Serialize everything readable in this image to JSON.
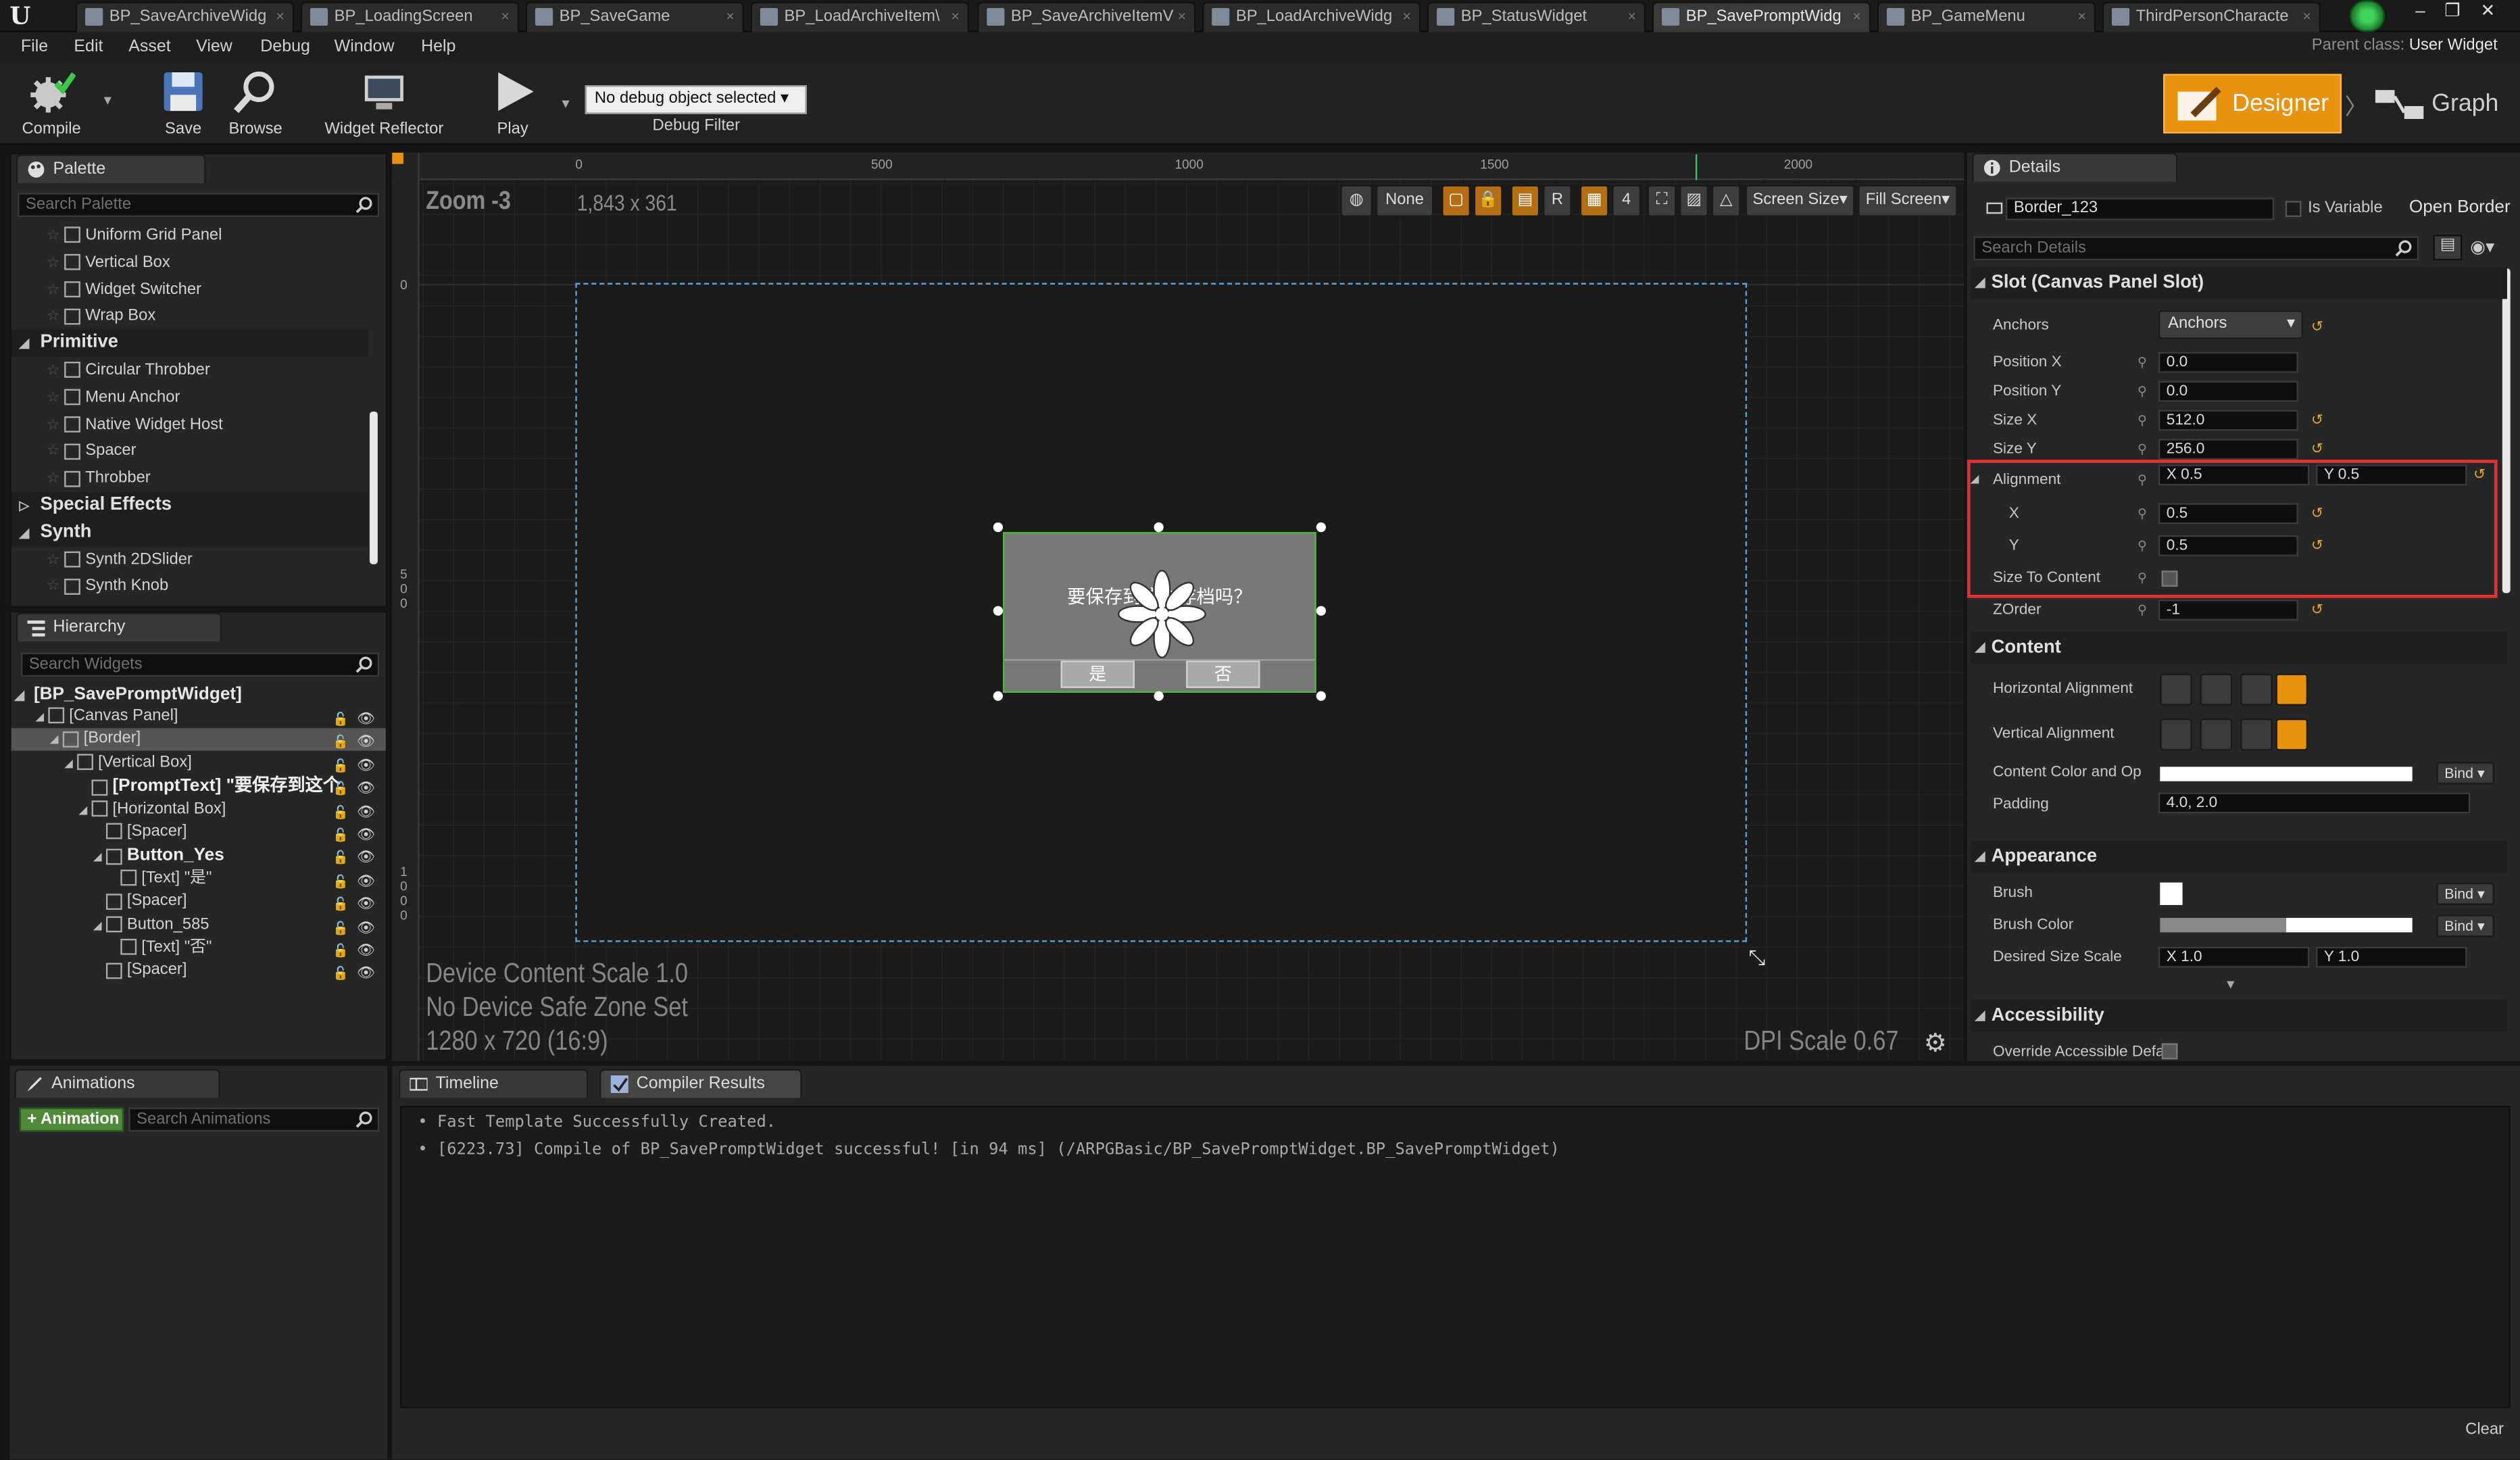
{
  "tabs": [
    {
      "label": "BP_SaveArchiveWidg",
      "active": false
    },
    {
      "label": "BP_LoadingScreen",
      "active": false
    },
    {
      "label": "BP_SaveGame",
      "active": false
    },
    {
      "label": "BP_LoadArchiveItem\\",
      "active": false
    },
    {
      "label": "BP_SaveArchiveItemV",
      "active": false
    },
    {
      "label": "BP_LoadArchiveWidg",
      "active": false
    },
    {
      "label": "BP_StatusWidget",
      "active": false
    },
    {
      "label": "BP_SavePromptWidg",
      "active": true
    },
    {
      "label": "BP_GameMenu",
      "active": false
    },
    {
      "label": "ThirdPersonCharacte",
      "active": false
    }
  ],
  "menu": {
    "items": [
      "File",
      "Edit",
      "Asset",
      "View",
      "Debug",
      "Window",
      "Help"
    ],
    "parent_class_label": "Parent class:",
    "parent_class_value": "User Widget"
  },
  "toolbar": {
    "compile": "Compile",
    "save": "Save",
    "browse": "Browse",
    "widget_reflector": "Widget Reflector",
    "play": "Play",
    "debug_select": "No debug object selected",
    "debug_filter": "Debug Filter",
    "designer": "Designer",
    "graph": "Graph"
  },
  "palette": {
    "title": "Palette",
    "search_placeholder": "Search Palette",
    "items": [
      {
        "type": "item",
        "label": "Uniform Grid Panel"
      },
      {
        "type": "item",
        "label": "Vertical Box"
      },
      {
        "type": "item",
        "label": "Widget Switcher"
      },
      {
        "type": "item",
        "label": "Wrap Box"
      },
      {
        "type": "cat",
        "label": "Primitive"
      },
      {
        "type": "item",
        "label": "Circular Throbber"
      },
      {
        "type": "item",
        "label": "Menu Anchor"
      },
      {
        "type": "item",
        "label": "Native Widget Host"
      },
      {
        "type": "item",
        "label": "Spacer"
      },
      {
        "type": "item",
        "label": "Throbber"
      },
      {
        "type": "cat",
        "label": "Special Effects"
      },
      {
        "type": "cat",
        "label": "Synth"
      },
      {
        "type": "item",
        "label": "Synth 2DSlider"
      },
      {
        "type": "item",
        "label": "Synth Knob"
      }
    ]
  },
  "hierarchy": {
    "title": "Hierarchy",
    "search_placeholder": "Search Widgets",
    "root": "[BP_SavePromptWidget]",
    "rows": [
      {
        "label": "[Canvas Panel]",
        "indent": 1,
        "bold": false,
        "selected": false
      },
      {
        "label": "[Border]",
        "indent": 2,
        "bold": false,
        "selected": true
      },
      {
        "label": "[Vertical Box]",
        "indent": 3,
        "bold": false,
        "selected": false
      },
      {
        "label": "[PromptText] \"要保存到这个",
        "indent": 4,
        "bold": true,
        "selected": false
      },
      {
        "label": "[Horizontal Box]",
        "indent": 4,
        "bold": false,
        "selected": false
      },
      {
        "label": "[Spacer]",
        "indent": 5,
        "bold": false,
        "selected": false
      },
      {
        "label": "Button_Yes",
        "indent": 5,
        "bold": true,
        "selected": false
      },
      {
        "label": "[Text] \"是\"",
        "indent": 6,
        "bold": false,
        "selected": false
      },
      {
        "label": "[Spacer]",
        "indent": 5,
        "bold": false,
        "selected": false
      },
      {
        "label": "Button_585",
        "indent": 5,
        "bold": false,
        "selected": false
      },
      {
        "label": "[Text] \"否\"",
        "indent": 6,
        "bold": false,
        "selected": false
      },
      {
        "label": "[Spacer]",
        "indent": 5,
        "bold": false,
        "selected": false
      }
    ]
  },
  "canvas": {
    "zoom": "Zoom -3",
    "resolution": "1,843 x 361",
    "ruler_top": [
      "0",
      "500",
      "1000",
      "1500",
      "2000"
    ],
    "ruler_left": [
      "0",
      "5",
      "0",
      "0",
      "1",
      "0",
      "0",
      "0"
    ],
    "toolbar": {
      "none": "None",
      "r": "R",
      "four": "4",
      "screen_size": "Screen Size",
      "fill_screen": "Fill Screen"
    },
    "device_scale": "Device Content Scale 1.0",
    "safe_zone": "No Device Safe Zone Set",
    "device_res": "1280 x 720 (16:9)",
    "dpi": "DPI Scale 0.67",
    "dialog": {
      "prompt": "要保存到这个存档吗？",
      "yes": "是",
      "no": "否"
    }
  },
  "details": {
    "title": "Details",
    "widget_name": "Border_123",
    "is_variable": "Is Variable",
    "open_border": "Open Border",
    "search_placeholder": "Search Details",
    "slot_section": "Slot (Canvas Panel Slot)",
    "anchors_label": "Anchors",
    "anchors_value": "Anchors",
    "position_x_label": "Position X",
    "position_x": "0.0",
    "position_y_label": "Position Y",
    "position_y": "0.0",
    "size_x_label": "Size X",
    "size_x": "512.0",
    "size_y_label": "Size Y",
    "size_y": "256.0",
    "alignment_label": "Alignment",
    "alignment_x": "X  0.5",
    "alignment_y": "Y  0.5",
    "x_label": "X",
    "x_value": "0.5",
    "y_label": "Y",
    "y_value": "0.5",
    "size_to_content": "Size To Content",
    "zorder_label": "ZOrder",
    "zorder": "-1",
    "content_section": "Content",
    "halign": "Horizontal Alignment",
    "valign": "Vertical Alignment",
    "content_color": "Content Color and Op",
    "bind": "Bind",
    "padding_label": "Padding",
    "padding": "4.0, 2.0",
    "appearance_section": "Appearance",
    "brush": "Brush",
    "brush_color": "Brush Color",
    "desired_size": "Desired Size Scale",
    "desired_x": "X  1.0",
    "desired_y": "Y  1.0",
    "accessibility_section": "Accessibility",
    "override_access": "Override Accessible Defau"
  },
  "animations": {
    "title": "Animations",
    "add_button": "+ Animation",
    "search_placeholder": "Search Animations"
  },
  "output": {
    "tab_timeline": "Timeline",
    "tab_compiler": "Compiler Results",
    "lines": [
      "•  Fast Template Successfully Created.",
      "•  [6223.73] Compile of BP_SavePromptWidget successful! [in 94 ms] (/ARPGBasic/BP_SavePromptWidget.BP_SavePromptWidget)"
    ],
    "clear": "Clear"
  },
  "colors": {
    "accent": "#e8920f",
    "selection_outline": "#e23030",
    "design_border": "#5aa2d8",
    "widget_border": "#49b83a"
  }
}
